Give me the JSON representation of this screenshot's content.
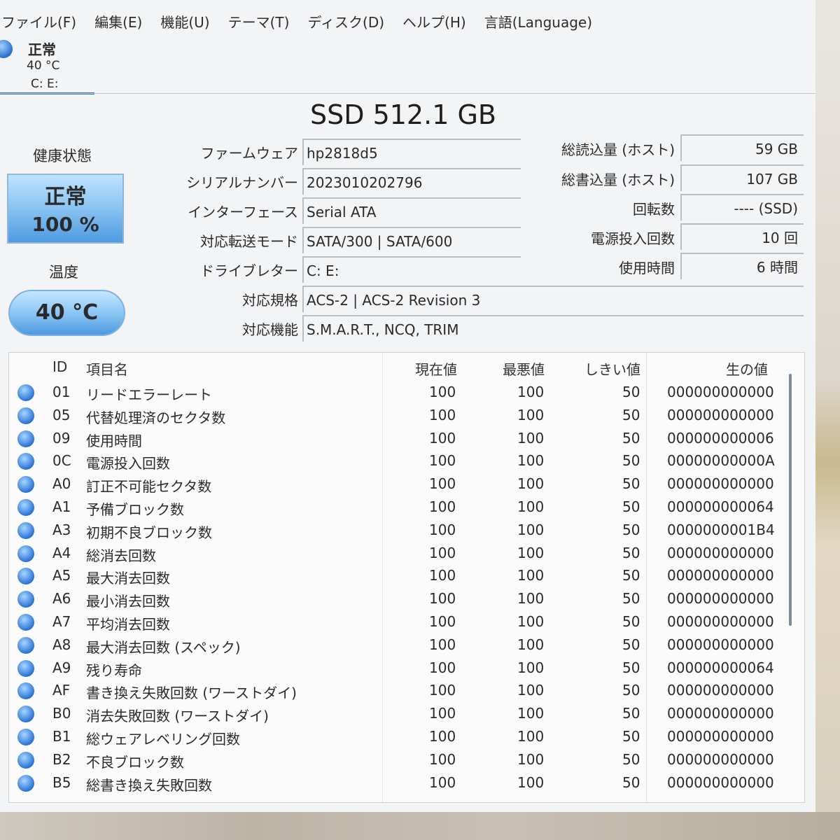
{
  "menu": [
    "ファイル(F)",
    "編集(E)",
    "機能(U)",
    "テーマ(T)",
    "ディスク(D)",
    "ヘルプ(H)",
    "言語(Language)"
  ],
  "disk_tab": {
    "status": "正常",
    "temp": "40 °C",
    "drives": "C: E:"
  },
  "model": "SSD 512.1 GB",
  "health": {
    "label": "健康状態",
    "status": "正常",
    "percent": "100 %"
  },
  "temperature": {
    "label": "温度",
    "value": "40 °C"
  },
  "info_left": [
    {
      "label": "ファームウェア",
      "value": "hp2818d5"
    },
    {
      "label": "シリアルナンバー",
      "value": "2023010202796"
    },
    {
      "label": "インターフェース",
      "value": "Serial ATA"
    },
    {
      "label": "対応転送モード",
      "value": "SATA/300 | SATA/600"
    },
    {
      "label": "ドライブレター",
      "value": "C: E:"
    }
  ],
  "info_full": [
    {
      "label": "対応規格",
      "value": "ACS-2 | ACS-2 Revision 3"
    },
    {
      "label": "対応機能",
      "value": "S.M.A.R.T., NCQ, TRIM"
    }
  ],
  "info_right": [
    {
      "label": "総読込量 (ホスト)",
      "value": "59 GB"
    },
    {
      "label": "総書込量 (ホスト)",
      "value": "107 GB"
    },
    {
      "label": "回転数",
      "value": "---- (SSD)"
    },
    {
      "label": "電源投入回数",
      "value": "10 回"
    },
    {
      "label": "使用時間",
      "value": "6 時間"
    }
  ],
  "smart_headers": {
    "id": "ID",
    "name": "項目名",
    "current": "現在値",
    "worst": "最悪値",
    "threshold": "しきい値",
    "raw": "生の値"
  },
  "smart_rows": [
    {
      "id": "01",
      "name": "リードエラーレート",
      "current": "100",
      "worst": "100",
      "threshold": "50",
      "raw": "000000000000"
    },
    {
      "id": "05",
      "name": "代替処理済のセクタ数",
      "current": "100",
      "worst": "100",
      "threshold": "50",
      "raw": "000000000000"
    },
    {
      "id": "09",
      "name": "使用時間",
      "current": "100",
      "worst": "100",
      "threshold": "50",
      "raw": "000000000006"
    },
    {
      "id": "0C",
      "name": "電源投入回数",
      "current": "100",
      "worst": "100",
      "threshold": "50",
      "raw": "00000000000A"
    },
    {
      "id": "A0",
      "name": "訂正不可能セクタ数",
      "current": "100",
      "worst": "100",
      "threshold": "50",
      "raw": "000000000000"
    },
    {
      "id": "A1",
      "name": "予備ブロック数",
      "current": "100",
      "worst": "100",
      "threshold": "50",
      "raw": "000000000064"
    },
    {
      "id": "A3",
      "name": "初期不良ブロック数",
      "current": "100",
      "worst": "100",
      "threshold": "50",
      "raw": "0000000001B4"
    },
    {
      "id": "A4",
      "name": "総消去回数",
      "current": "100",
      "worst": "100",
      "threshold": "50",
      "raw": "000000000000"
    },
    {
      "id": "A5",
      "name": "最大消去回数",
      "current": "100",
      "worst": "100",
      "threshold": "50",
      "raw": "000000000000"
    },
    {
      "id": "A6",
      "name": "最小消去回数",
      "current": "100",
      "worst": "100",
      "threshold": "50",
      "raw": "000000000000"
    },
    {
      "id": "A7",
      "name": "平均消去回数",
      "current": "100",
      "worst": "100",
      "threshold": "50",
      "raw": "000000000000"
    },
    {
      "id": "A8",
      "name": "最大消去回数 (スペック)",
      "current": "100",
      "worst": "100",
      "threshold": "50",
      "raw": "000000000000"
    },
    {
      "id": "A9",
      "name": "残り寿命",
      "current": "100",
      "worst": "100",
      "threshold": "50",
      "raw": "000000000064"
    },
    {
      "id": "AF",
      "name": "書き換え失敗回数 (ワーストダイ)",
      "current": "100",
      "worst": "100",
      "threshold": "50",
      "raw": "000000000000"
    },
    {
      "id": "B0",
      "name": "消去失敗回数 (ワーストダイ)",
      "current": "100",
      "worst": "100",
      "threshold": "50",
      "raw": "000000000000"
    },
    {
      "id": "B1",
      "name": "総ウェアレベリング回数",
      "current": "100",
      "worst": "100",
      "threshold": "50",
      "raw": "000000000000"
    },
    {
      "id": "B2",
      "name": "不良ブロック数",
      "current": "100",
      "worst": "100",
      "threshold": "50",
      "raw": "000000000000"
    },
    {
      "id": "B5",
      "name": "総書き換え失敗回数",
      "current": "100",
      "worst": "100",
      "threshold": "50",
      "raw": "000000000000"
    }
  ]
}
